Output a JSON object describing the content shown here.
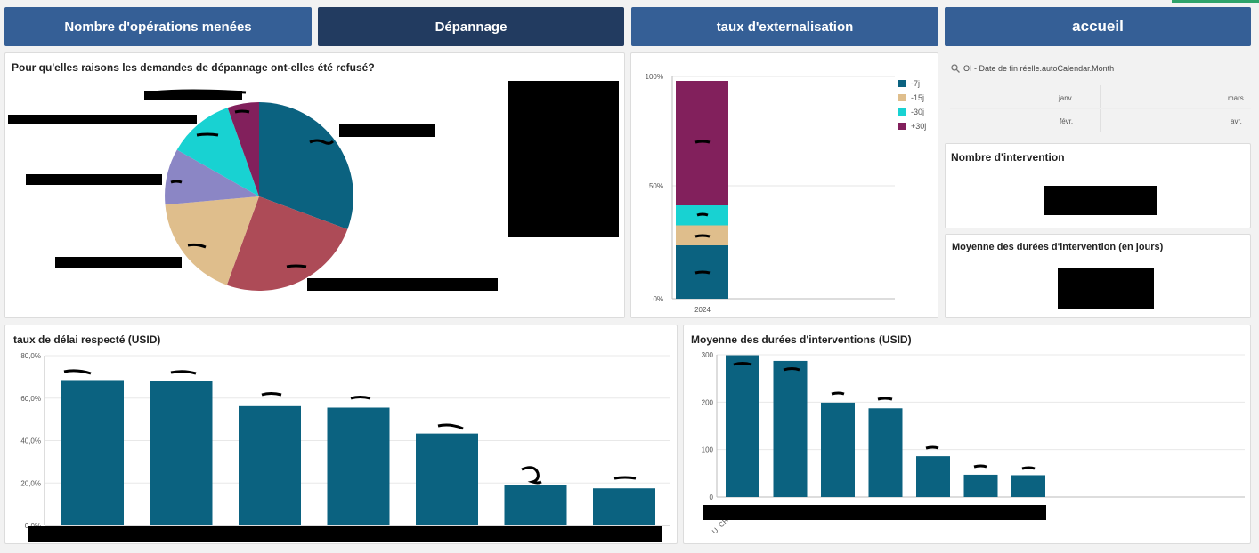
{
  "nav": {
    "operations": "Nombre d'opérations menées",
    "depannage": "Dépannage",
    "externalisation": "taux d'externalisation",
    "accueil": "accueil"
  },
  "colors": {
    "nav_button": "#355f96",
    "nav_active": "#223b60",
    "teal": "#0b6280",
    "rose": "#ad4b57",
    "tan": "#dfbe8c",
    "lavender": "#8b86c5",
    "cyan": "#18d2d2",
    "plum": "#82205c",
    "green_edge": "#2fa36b"
  },
  "pie_panel": {
    "title": "Pour qu'elles raisons les demandes de dépannage ont-elles été refusé?"
  },
  "stack_panel": {
    "chart_data": {
      "type": "bar",
      "stacked": true,
      "categories": [
        "2024"
      ],
      "series": [
        {
          "name": "-7j",
          "values": [
            24
          ],
          "color": "#0b6280"
        },
        {
          "name": "-15j",
          "values": [
            9
          ],
          "color": "#dfbe8c"
        },
        {
          "name": "-30j",
          "values": [
            9
          ],
          "color": "#18d2d2"
        },
        {
          "name": "+30j",
          "values": [
            56
          ],
          "color": "#82205c"
        }
      ],
      "yticks": [
        "0%",
        "50%",
        "100%"
      ],
      "ylim": [
        0,
        100
      ],
      "legend": "top-right"
    }
  },
  "filter": {
    "icon": "search-icon",
    "label": "OI - Date de fin réelle.autoCalendar.Month",
    "months": [
      "janv.",
      "mars",
      "févr.",
      "avr."
    ]
  },
  "kpi1": {
    "title": "Nombre d'intervention"
  },
  "kpi2": {
    "title": "Moyenne des durées d'intervention (en jours)"
  },
  "bar_left": {
    "title": "taux de délai respecté (USID)",
    "chart_data": {
      "type": "bar",
      "values": [
        68.5,
        68.0,
        56.2,
        55.5,
        43.3,
        19.0,
        17.5
      ],
      "yticks": [
        "0,0%",
        "20,0%",
        "40,0%",
        "60,0%",
        "80,0%"
      ],
      "ylim": [
        0,
        80
      ],
      "grid": true
    }
  },
  "bar_right": {
    "title": "Moyenne des durées d'interventions (USID)",
    "chart_data": {
      "type": "bar",
      "values": [
        299,
        287,
        199,
        187,
        86,
        47,
        46
      ],
      "yticks": [
        "0",
        "100",
        "200",
        "300"
      ],
      "ylim": [
        0,
        300
      ],
      "grid": true,
      "first_category_fragment": "U. CR"
    }
  }
}
